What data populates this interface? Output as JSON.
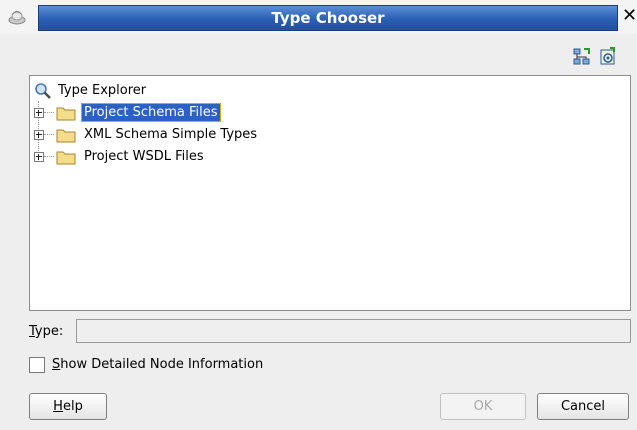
{
  "window": {
    "title": "Type Chooser",
    "close_glyph": "✕"
  },
  "toolbar": {
    "buttons": [
      {
        "icon": "import-schema-icon"
      },
      {
        "icon": "import-wsdl-icon"
      }
    ]
  },
  "tree": {
    "root": {
      "icon": "magnifier-icon",
      "label": "Type Explorer"
    },
    "nodes": [
      {
        "label": "Project Schema Files",
        "selected": true,
        "icon": "folder-icon"
      },
      {
        "label": "XML Schema Simple Types",
        "selected": false,
        "icon": "folder-icon"
      },
      {
        "label": "Project WSDL Files",
        "selected": false,
        "icon": "folder-icon"
      }
    ]
  },
  "type_field": {
    "label_mnemonic": "T",
    "label_rest": "ype:",
    "value": ""
  },
  "detail_checkbox": {
    "checked": false,
    "label_mnemonic": "S",
    "label_rest": "how Detailed Node Information"
  },
  "buttons": {
    "help": {
      "mnemonic": "H",
      "rest": "elp"
    },
    "ok": {
      "label": "OK",
      "enabled": false
    },
    "cancel": {
      "label": "Cancel"
    }
  },
  "colors": {
    "title_blue": "#2a5fb4",
    "selection_blue": "#2b60c6",
    "focus_gold": "#e0b400"
  }
}
